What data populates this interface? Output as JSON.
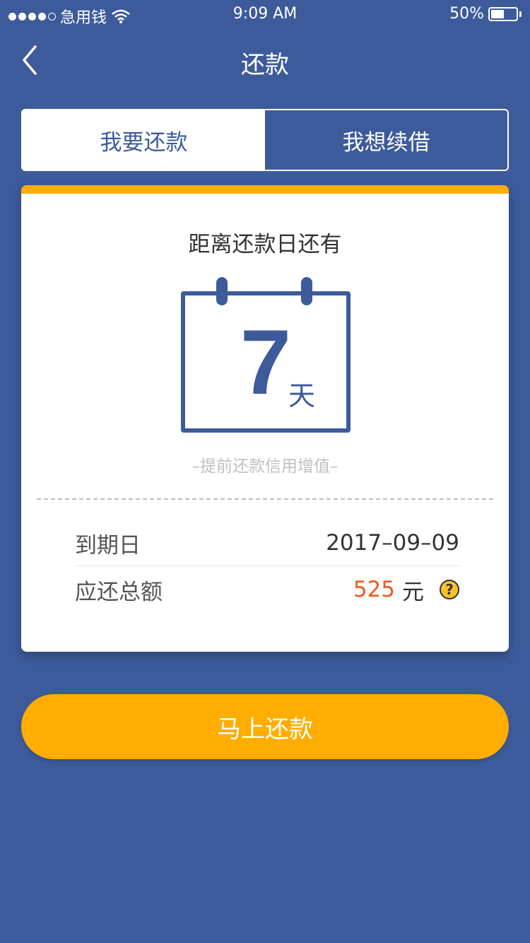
{
  "status_bar": {
    "carrier": "急用钱",
    "time": "9:09 AM",
    "battery": "50%",
    "signal_icon": "signal-dots-icon",
    "wifi_icon": "wifi-icon",
    "battery_icon": "battery-icon"
  },
  "nav": {
    "title": "还款",
    "back_icon": "chevron-left-icon"
  },
  "tabs": [
    {
      "label": "我要还款",
      "active": true
    },
    {
      "label": "我想续借",
      "active": false
    }
  ],
  "countdown": {
    "title": "距离还款日还有",
    "days": "7",
    "unit": "天",
    "tip": "–提前还款信用增值–"
  },
  "details": {
    "due_label": "到期日",
    "due_value": "2017–09–09",
    "total_label": "应还总额",
    "total_value": "525",
    "total_unit": "元",
    "help_icon": "question-circle-icon",
    "help_symbol": "?"
  },
  "action": {
    "label": "马上还款"
  },
  "colors": {
    "primary": "#3d5b9b",
    "accent": "#ffad00",
    "amount": "#f2581e"
  }
}
